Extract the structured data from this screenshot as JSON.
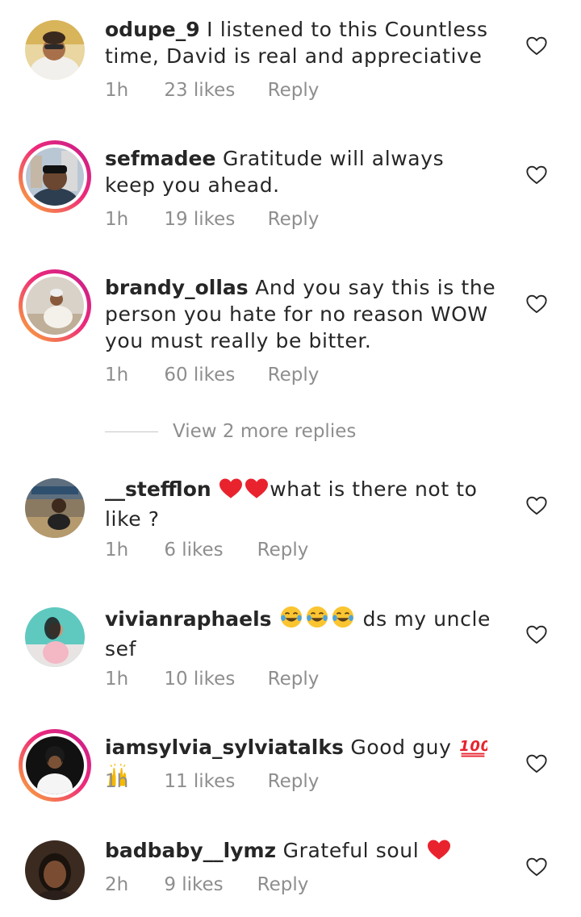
{
  "comments": [
    {
      "username": "odupe_9",
      "text": "I listened to this Countless time, David is real and appreciative",
      "time": "1h",
      "likes": "23 likes",
      "reply": "Reply"
    },
    {
      "username": "sefmadee",
      "text": "Gratitude will always keep you ahead.",
      "time": "1h",
      "likes": "19 likes",
      "reply": "Reply"
    },
    {
      "username": "brandy_ollas",
      "text": "And you say this is the person you hate for no reason WOW you must really be bitter.",
      "time": "1h",
      "likes": "60 likes",
      "reply": "Reply"
    },
    {
      "username": "__stefflon",
      "text": "what is there not to like ?",
      "time": "1h",
      "likes": "6 likes",
      "reply": "Reply"
    },
    {
      "username": "vivianraphaels",
      "text": "ds my uncle sef",
      "time": "1h",
      "likes": "10 likes",
      "reply": "Reply"
    },
    {
      "username": "iamsylvia_sylviatalks",
      "text": "Good guy",
      "time": "1h",
      "likes": "11 likes",
      "reply": "Reply"
    },
    {
      "username": "badbaby__lymz",
      "text": "Grateful soul",
      "time": "2h",
      "likes": "9 likes",
      "reply": "Reply"
    }
  ],
  "view_replies": "View 2 more replies",
  "icons": {
    "like": "heart-outline-icon",
    "emoji_heart": "red-heart-emoji",
    "emoji_laugh": "tears-of-joy-emoji",
    "emoji_hundred": "hundred-points-emoji",
    "emoji_raised_hands": "raised-hands-emoji"
  },
  "colors": {
    "text": "#262626",
    "meta": "#8e8e8e",
    "story_ring_start": "#f9b234",
    "story_ring_end": "#c41d8b",
    "heart_emoji": "#e8232e"
  }
}
